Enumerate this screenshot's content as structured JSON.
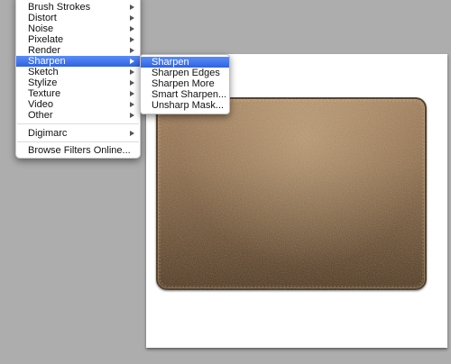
{
  "filter_menu": {
    "items": [
      {
        "label": "Brush Strokes",
        "has_submenu": true
      },
      {
        "label": "Distort",
        "has_submenu": true
      },
      {
        "label": "Noise",
        "has_submenu": true
      },
      {
        "label": "Pixelate",
        "has_submenu": true
      },
      {
        "label": "Render",
        "has_submenu": true
      },
      {
        "label": "Sharpen",
        "has_submenu": true,
        "selected": true
      },
      {
        "label": "Sketch",
        "has_submenu": true
      },
      {
        "label": "Stylize",
        "has_submenu": true
      },
      {
        "label": "Texture",
        "has_submenu": true
      },
      {
        "label": "Video",
        "has_submenu": true
      },
      {
        "label": "Other",
        "has_submenu": true
      }
    ],
    "digimarc": {
      "label": "Digimarc",
      "has_submenu": true
    },
    "browse_online": {
      "label": "Browse Filters Online..."
    }
  },
  "sharpen_submenu": {
    "items": [
      {
        "label": "Sharpen",
        "selected": true
      },
      {
        "label": "Sharpen Edges"
      },
      {
        "label": "Sharpen More"
      },
      {
        "label": "Smart Sharpen..."
      },
      {
        "label": "Unsharp Mask..."
      }
    ]
  },
  "colors": {
    "menu_highlight": "#3a6ee8",
    "background": "#adadad",
    "leather_top": "#a07b54",
    "leather_bottom": "#4a3218"
  }
}
